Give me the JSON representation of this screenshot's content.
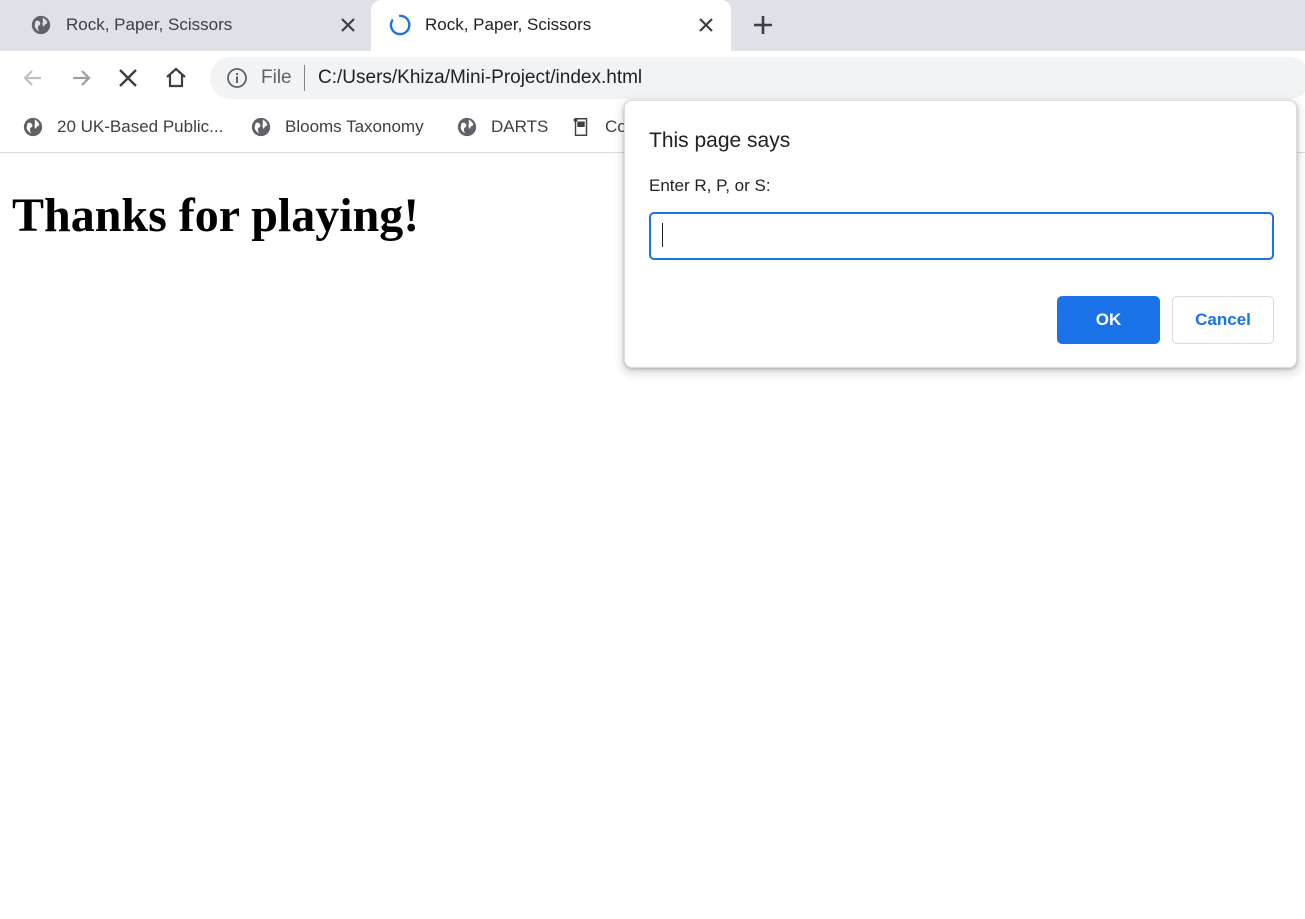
{
  "tabs": [
    {
      "title": "Rock, Paper, Scissors",
      "state": "inactive",
      "icon": "globe-icon"
    },
    {
      "title": "Rock, Paper, Scissors",
      "state": "active-loading",
      "icon": "loading-spinner-icon"
    }
  ],
  "toolbar": {
    "scheme": "File",
    "url": "C:/Users/Khiza/Mini-Project/index.html"
  },
  "bookmarks": [
    {
      "label": "20 UK-Based Public...",
      "icon": "globe-icon"
    },
    {
      "label": "Blooms Taxonomy",
      "icon": "globe-icon"
    },
    {
      "label": "DARTS",
      "icon": "globe-icon"
    },
    {
      "label": "Co",
      "icon": "document-icon"
    }
  ],
  "page": {
    "heading": "Thanks for playing!"
  },
  "dialog": {
    "title": "This page says",
    "message": "Enter R, P, or S:",
    "input_value": "",
    "ok_label": "OK",
    "cancel_label": "Cancel"
  },
  "colors": {
    "accent": "#1a73e8",
    "tabstrip": "#dee1e6",
    "omnibox": "#f1f3f4"
  }
}
